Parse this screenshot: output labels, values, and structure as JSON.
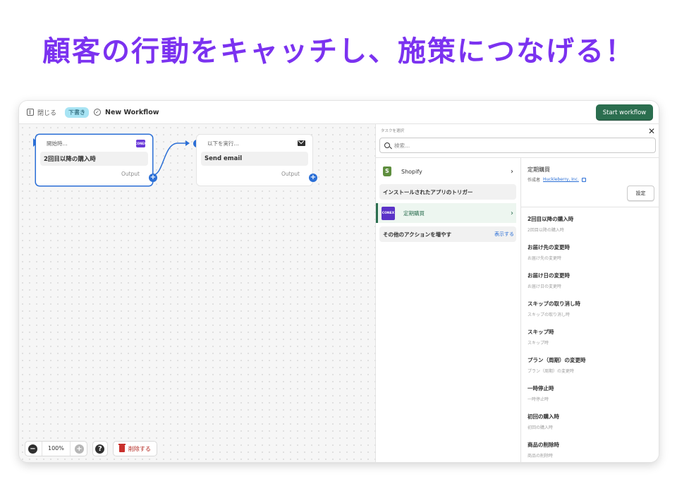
{
  "headline": "顧客の行動をキャッチし、施策につなげる！",
  "topbar": {
    "close_label": "閉じる",
    "status_badge": "下書き",
    "workflow_name": "New Workflow",
    "start_button": "Start workflow"
  },
  "canvas": {
    "trigger_node": {
      "header": "開始時...",
      "body": "2回目以降の購入時",
      "footer": "Output",
      "app_logo_text": "CONEX"
    },
    "action_node": {
      "header": "以下を実行...",
      "body": "Send email",
      "footer": "Output"
    },
    "toolbar": {
      "zoom": "100%",
      "help": "?",
      "delete_label": "削除する"
    }
  },
  "panel": {
    "title": "タスクを選択",
    "close": "✕",
    "search_placeholder": "検索...",
    "apps": {
      "shopify_label": "Shopify",
      "installed_section": "インストールされたアプリのトリガー",
      "selected_app_label": "定期購買",
      "selected_app_logo": "CONEX",
      "more_section": "その他のアクションを増やす",
      "more_link": "表示する"
    },
    "detail": {
      "title": "定期購買",
      "author_prefix": "作成者",
      "author_link": "Huckleberry, Inc.",
      "settings_button": "設定",
      "triggers": [
        {
          "name": "2回目以降の購入時",
          "desc": "2回目以降の購入時"
        },
        {
          "name": "お届け先の変更時",
          "desc": "お届け先の変更時"
        },
        {
          "name": "お届け日の変更時",
          "desc": "お届け日の変更時"
        },
        {
          "name": "スキップの取り消し時",
          "desc": "スキップの取り消し時"
        },
        {
          "name": "スキップ時",
          "desc": "スキップ時"
        },
        {
          "name": "プラン（周期）の変更時",
          "desc": "プラン（周期）の変更時"
        },
        {
          "name": "一時停止時",
          "desc": "一時停止時"
        },
        {
          "name": "初回の購入時",
          "desc": "初回の購入時"
        },
        {
          "name": "商品の削除時",
          "desc": "商品の削除時"
        }
      ]
    }
  },
  "colors": {
    "headline": "#7b32f0",
    "primary_button": "#2b6e4f",
    "connector": "#2b6fd6",
    "app_brand": "#5a33c7"
  }
}
